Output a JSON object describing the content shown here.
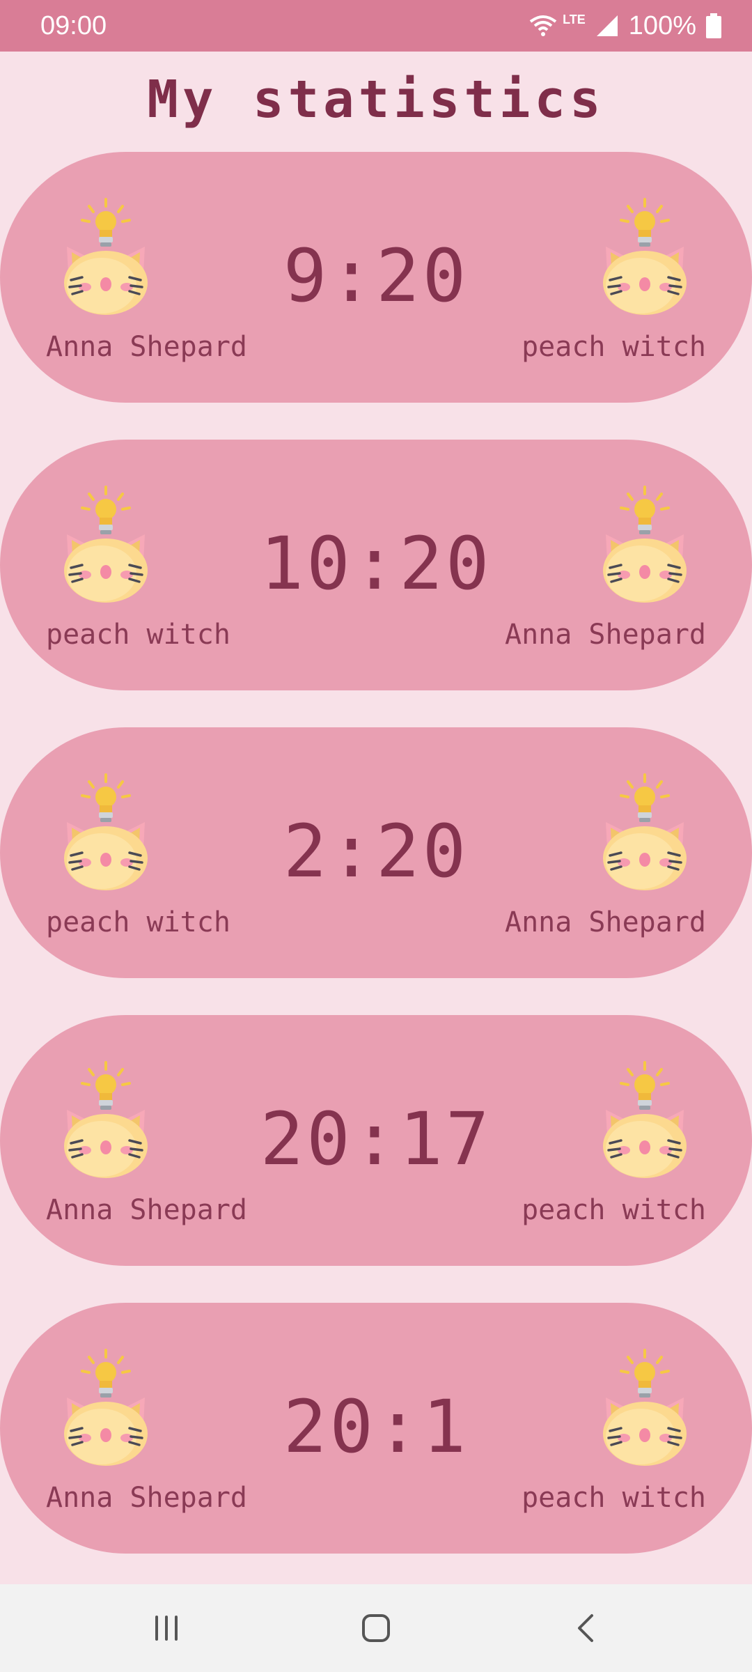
{
  "status_bar": {
    "time": "09:00",
    "network": "LTE",
    "battery": "100%",
    "icons": [
      "wifi-icon",
      "signal-icon",
      "battery-icon"
    ]
  },
  "title": "My statistics",
  "colors": {
    "background": "#f8e1e8",
    "status_bar": "#d97d96",
    "card": "#e99fb2",
    "text_dark": "#85334f",
    "nav_bar": "#f2f2f2"
  },
  "avatar_icon": "cat-lightbulb-icon",
  "matches": [
    {
      "left_player": "Anna Shepard",
      "score": "9:20",
      "right_player": "peach witch"
    },
    {
      "left_player": "peach witch",
      "score": "10:20",
      "right_player": "Anna Shepard"
    },
    {
      "left_player": "peach witch",
      "score": "2:20",
      "right_player": "Anna Shepard"
    },
    {
      "left_player": "Anna Shepard",
      "score": "20:17",
      "right_player": "peach witch"
    },
    {
      "left_player": "Anna Shepard",
      "score": "20:1",
      "right_player": "peach witch"
    }
  ],
  "nav": {
    "buttons": [
      "recent-apps-icon",
      "home-icon",
      "back-icon"
    ]
  }
}
